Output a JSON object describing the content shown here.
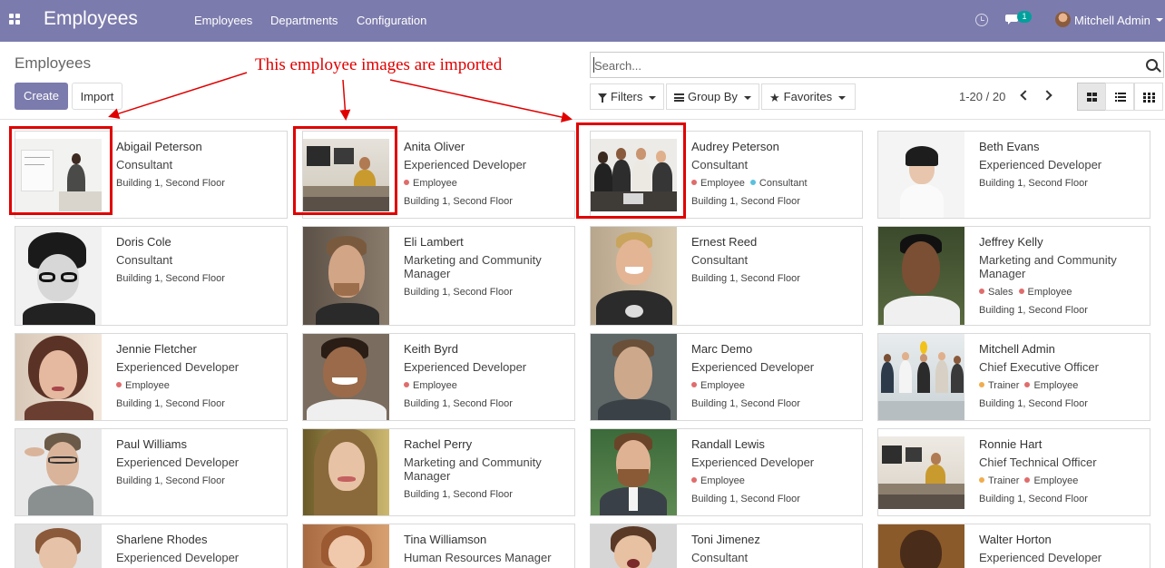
{
  "navbar": {
    "brand": "Employees",
    "menu": [
      "Employees",
      "Departments",
      "Configuration"
    ],
    "messages_count": "1",
    "user_name": "Mitchell Admin"
  },
  "control_panel": {
    "title": "Employees",
    "create_label": "Create",
    "import_label": "Import",
    "search_placeholder": "Search...",
    "filters_label": "Filters",
    "group_by_label": "Group By",
    "favorites_label": "Favorites",
    "pager": "1-20 / 20"
  },
  "annotation": {
    "text": "This employee images are imported",
    "color": "#e00000"
  },
  "colors": {
    "brand": "#7c7bad",
    "tag_red": "#e06c6c",
    "tag_blue": "#5bc0de",
    "tag_orange": "#f0ad4e"
  },
  "employees": [
    {
      "name": "Abigail Peterson",
      "job": "Consultant",
      "tags": [],
      "location": "Building 1, Second Floor"
    },
    {
      "name": "Anita Oliver",
      "job": "Experienced Developer",
      "tags": [
        {
          "label": "Employee",
          "color": "#e06c6c"
        }
      ],
      "location": "Building 1, Second Floor"
    },
    {
      "name": "Audrey Peterson",
      "job": "Consultant",
      "tags": [
        {
          "label": "Employee",
          "color": "#e06c6c"
        },
        {
          "label": "Consultant",
          "color": "#5bc0de"
        }
      ],
      "location": "Building 1, Second Floor"
    },
    {
      "name": "Beth Evans",
      "job": "Experienced Developer",
      "tags": [],
      "location": "Building 1, Second Floor"
    },
    {
      "name": "Doris Cole",
      "job": "Consultant",
      "tags": [],
      "location": "Building 1, Second Floor"
    },
    {
      "name": "Eli Lambert",
      "job": "Marketing and Community Manager",
      "tags": [],
      "location": "Building 1, Second Floor"
    },
    {
      "name": "Ernest Reed",
      "job": "Consultant",
      "tags": [],
      "location": "Building 1, Second Floor"
    },
    {
      "name": "Jeffrey Kelly",
      "job": "Marketing and Community Manager",
      "tags": [
        {
          "label": "Sales",
          "color": "#e06c6c"
        },
        {
          "label": "Employee",
          "color": "#e06c6c"
        }
      ],
      "location": "Building 1, Second Floor"
    },
    {
      "name": "Jennie Fletcher",
      "job": "Experienced Developer",
      "tags": [
        {
          "label": "Employee",
          "color": "#e06c6c"
        }
      ],
      "location": "Building 1, Second Floor"
    },
    {
      "name": "Keith Byrd",
      "job": "Experienced Developer",
      "tags": [
        {
          "label": "Employee",
          "color": "#e06c6c"
        }
      ],
      "location": "Building 1, Second Floor"
    },
    {
      "name": "Marc Demo",
      "job": "Experienced Developer",
      "tags": [
        {
          "label": "Employee",
          "color": "#e06c6c"
        }
      ],
      "location": "Building 1, Second Floor"
    },
    {
      "name": "Mitchell Admin",
      "job": "Chief Executive Officer",
      "tags": [
        {
          "label": "Trainer",
          "color": "#f0ad4e"
        },
        {
          "label": "Employee",
          "color": "#e06c6c"
        }
      ],
      "location": "Building 1, Second Floor"
    },
    {
      "name": "Paul Williams",
      "job": "Experienced Developer",
      "tags": [],
      "location": "Building 1, Second Floor"
    },
    {
      "name": "Rachel Perry",
      "job": "Marketing and Community Manager",
      "tags": [],
      "location": "Building 1, Second Floor"
    },
    {
      "name": "Randall Lewis",
      "job": "Experienced Developer",
      "tags": [
        {
          "label": "Employee",
          "color": "#e06c6c"
        }
      ],
      "location": "Building 1, Second Floor"
    },
    {
      "name": "Ronnie Hart",
      "job": "Chief Technical Officer",
      "tags": [
        {
          "label": "Trainer",
          "color": "#f0ad4e"
        },
        {
          "label": "Employee",
          "color": "#e06c6c"
        }
      ],
      "location": "Building 1, Second Floor"
    },
    {
      "name": "Sharlene Rhodes",
      "job": "Experienced Developer",
      "tags": [],
      "location": ""
    },
    {
      "name": "Tina Williamson",
      "job": "Human Resources Manager",
      "tags": [],
      "location": ""
    },
    {
      "name": "Toni Jimenez",
      "job": "Consultant",
      "tags": [],
      "location": ""
    },
    {
      "name": "Walter Horton",
      "job": "Experienced Developer",
      "tags": [],
      "location": ""
    }
  ]
}
